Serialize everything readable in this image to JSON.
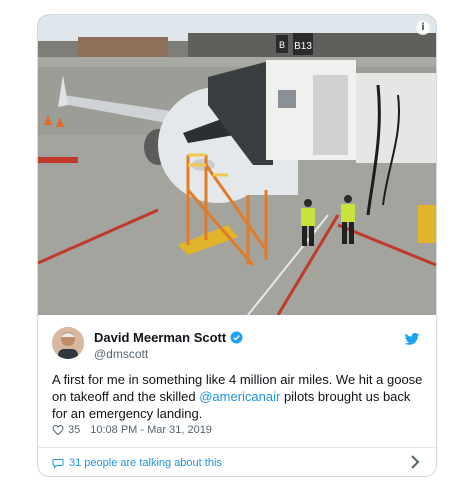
{
  "tweet": {
    "author_name": "David Meerman Scott",
    "handle": "@dmscott",
    "text_before": "A first for me in something like 4 million air miles. We hit a goose on takeoff and the skilled ",
    "mention": "@americanair",
    "text_after": " pilots brought us back for an emergency landing.",
    "likes": "35",
    "timestamp": "10:08 PM - Mar 31, 2019",
    "conversation": "31 people are talking about this"
  },
  "photo": {
    "gate_sign": "B13",
    "gate_sign_small": "B",
    "info": "i"
  },
  "colors": {
    "link": "#1b95e0",
    "text": "#0f1419",
    "muted": "#536471",
    "verified": "#1da1f2"
  },
  "icons": [
    "info-icon",
    "verified-icon",
    "twitter-bird-icon",
    "heart-icon",
    "comment-bubble-icon",
    "chevron-right-icon"
  ]
}
